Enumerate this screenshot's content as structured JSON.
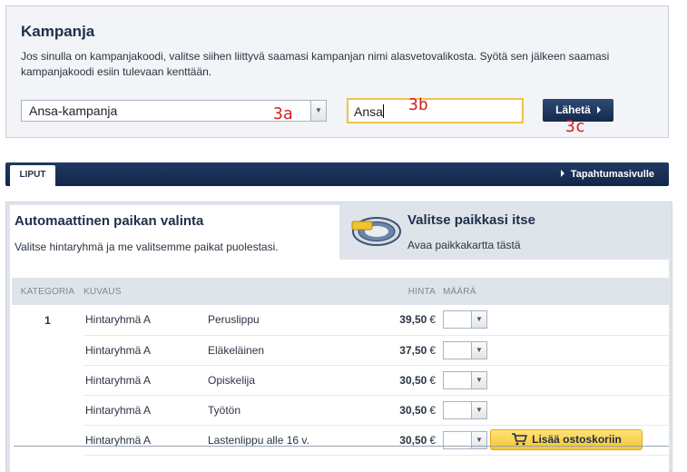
{
  "campaign": {
    "title": "Kampanja",
    "description": "Jos sinulla on kampanjakoodi, valitse siihen liittyvä saamasi kampanjan nimi alasvetovalikosta. Syötä sen jälkeen saamasi kampanjakoodi esiin tulevaan kenttään.",
    "selected_campaign": "Ansa-kampanja",
    "code_value": "Ansa",
    "submit_label": "Lähetä",
    "annotations": {
      "a": "3a",
      "b": "3b",
      "c": "3c"
    }
  },
  "tabs": {
    "active": "LIPUT",
    "event_link": "Tapahtumasivulle"
  },
  "seat_selection": {
    "auto": {
      "title": "Automaattinen paikan valinta",
      "description": "Valitse hintaryhmä ja me valitsemme paikat puolestasi."
    },
    "self": {
      "title": "Valitse paikkasi itse",
      "description": "Avaa paikkakartta tästä"
    }
  },
  "price_table": {
    "headers": {
      "category": "KATEGORIA",
      "description": "KUVAUS",
      "price": "HINTA",
      "quantity": "MÄÄRÄ"
    },
    "category": "1",
    "currency": "€",
    "rows": [
      {
        "group": "Hintaryhmä A",
        "type": "Peruslippu",
        "price": "39,50"
      },
      {
        "group": "Hintaryhmä A",
        "type": "Eläkeläinen",
        "price": "37,50"
      },
      {
        "group": "Hintaryhmä A",
        "type": "Opiskelija",
        "price": "30,50"
      },
      {
        "group": "Hintaryhmä A",
        "type": "Työtön",
        "price": "30,50"
      },
      {
        "group": "Hintaryhmä A",
        "type": "Lastenlippu alle 16 v.",
        "price": "30,50"
      }
    ],
    "add_to_cart_label": "Lisää ostoskoriin"
  }
}
